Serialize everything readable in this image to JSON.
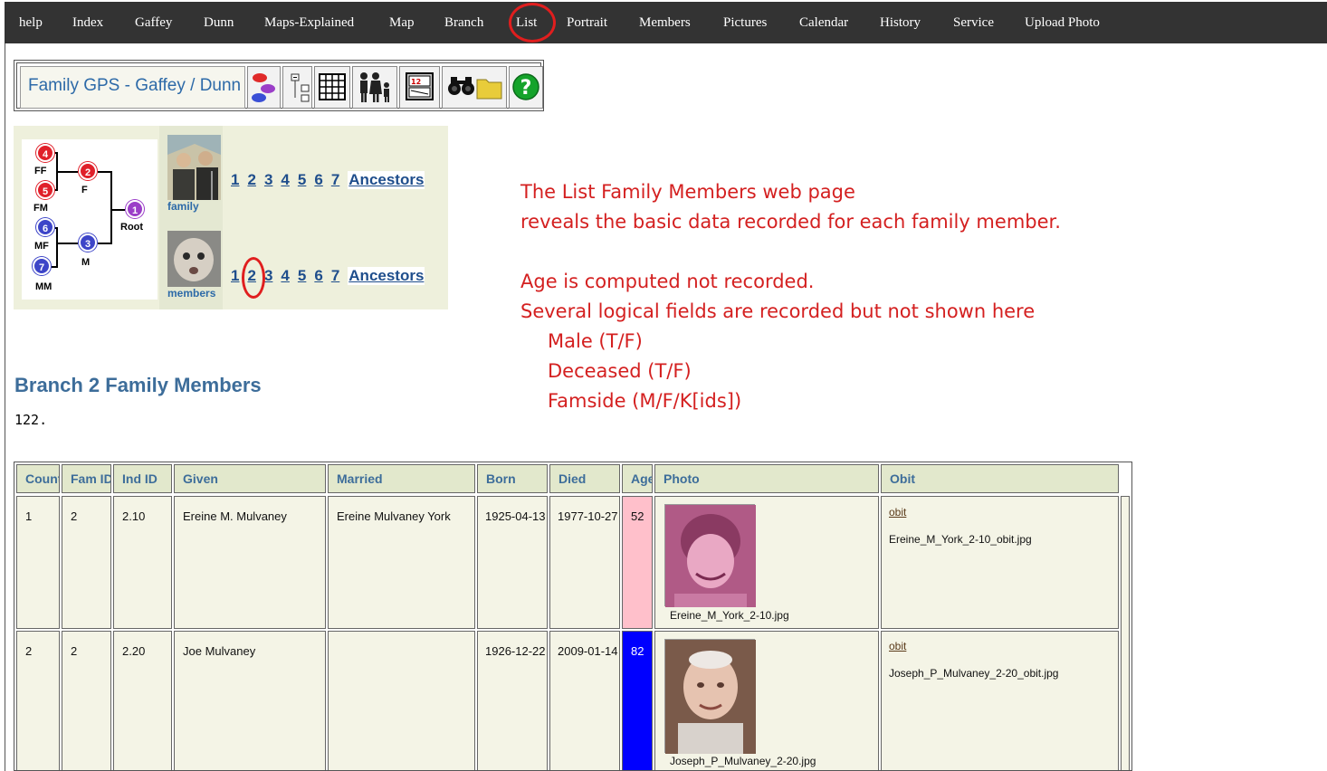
{
  "nav": {
    "items": [
      "help",
      "Index",
      "Gaffey",
      "Dunn",
      "Maps-Explained",
      "Map",
      "Branch",
      "List",
      "Portrait",
      "Members",
      "Pictures",
      "Calendar",
      "History",
      "Service",
      "Upload Photo"
    ],
    "active": "List"
  },
  "toolbar": {
    "title": "Family GPS - Gaffey / Dunn",
    "buttons": [
      "ovals-icon",
      "expand-collapse-icon",
      "grid-calendar-icon",
      "family-people-icon",
      "id-card-icon",
      "binoculars-folder-icon",
      "help-question-icon"
    ]
  },
  "branch": {
    "tree": {
      "nodes": [
        {
          "num": "4",
          "label": "FF"
        },
        {
          "num": "5",
          "label": "FM"
        },
        {
          "num": "2",
          "label": "F"
        },
        {
          "num": "6",
          "label": "MF"
        },
        {
          "num": "7",
          "label": "MM"
        },
        {
          "num": "3",
          "label": "M"
        },
        {
          "num": "1",
          "label": "Root"
        }
      ]
    },
    "family_label": "family",
    "members_label": "members",
    "numbers": [
      "1",
      "2",
      "3",
      "4",
      "5",
      "6",
      "7"
    ],
    "ancestors_label": "Ancestors",
    "highlighted_number": "2"
  },
  "annotation": {
    "lines": [
      "The List Family Members web page",
      "reveals the basic data recorded for each family member.",
      "Age is computed not recorded.",
      "Several logical fields are recorded but not shown here",
      "Male (T/F)",
      "Deceased (T/F)",
      "Famside (M/F/K[ids])"
    ]
  },
  "page": {
    "title": "Branch 2 Family Members",
    "count": "122."
  },
  "table": {
    "headers": [
      "Count",
      "Fam ID",
      "Ind ID",
      "Given",
      "Married",
      "Born",
      "Died",
      "Age",
      "Photo",
      "Obit"
    ],
    "rows": [
      {
        "count": "1",
        "fam_id": "2",
        "ind_id": "2.10",
        "given": "Ereine M. Mulvaney",
        "married": "Ereine Mulvaney York",
        "born": "1925-04-13",
        "died": "1977-10-27",
        "age": "52",
        "age_color": "#ffc0cb",
        "photo_file": "Ereine_M_York_2-10.jpg",
        "obit_link": "obit",
        "obit_file": "Ereine_M_York_2-10_obit.jpg"
      },
      {
        "count": "2",
        "fam_id": "2",
        "ind_id": "2.20",
        "given": "Joe Mulvaney",
        "married": "",
        "born": "1926-12-22",
        "died": "2009-01-14",
        "age": "82",
        "age_color": "#0000ff",
        "photo_file": "Joseph_P_Mulvaney_2-20.jpg",
        "obit_link": "obit",
        "obit_file": "Joseph_P_Mulvaney_2-20_obit.jpg"
      }
    ]
  }
}
